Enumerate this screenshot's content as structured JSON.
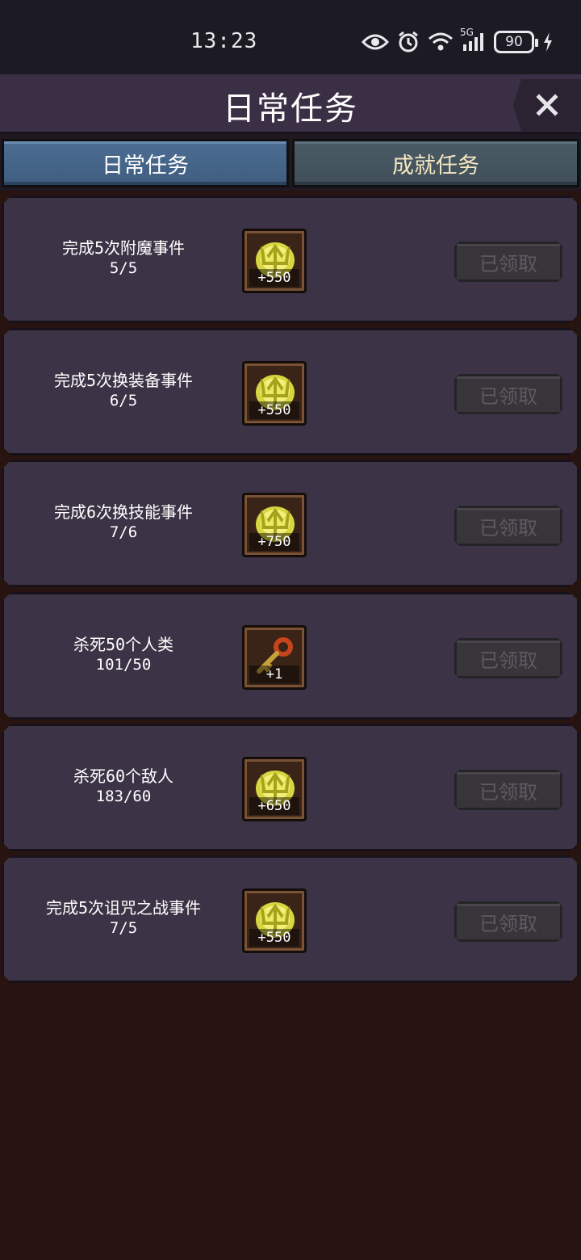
{
  "status_bar": {
    "time": "13:23",
    "network": "5G",
    "battery": "90",
    "icons": [
      "eye-icon",
      "alarm-icon",
      "wifi-icon",
      "signal-icon",
      "battery-icon",
      "charging-icon"
    ]
  },
  "header": {
    "title": "日常任务",
    "close_icon": "close-icon"
  },
  "tabs": [
    {
      "label": "日常任务",
      "active": true
    },
    {
      "label": "成就任务",
      "active": false
    }
  ],
  "tasks": [
    {
      "title": "完成5次附魔事件",
      "progress": "5/5",
      "reward_icon": "gold-crown-icon",
      "reward_amount": "+550",
      "button": "已领取"
    },
    {
      "title": "完成5次换装备事件",
      "progress": "6/5",
      "reward_icon": "gold-crown-icon",
      "reward_amount": "+550",
      "button": "已领取"
    },
    {
      "title": "完成6次换技能事件",
      "progress": "7/6",
      "reward_icon": "gold-crown-icon",
      "reward_amount": "+750",
      "button": "已领取"
    },
    {
      "title": "杀死50个人类",
      "progress": "101/50",
      "reward_icon": "key-icon",
      "reward_amount": "+1",
      "button": "已领取"
    },
    {
      "title": "杀死60个敌人",
      "progress": "183/60",
      "reward_icon": "gold-crown-icon",
      "reward_amount": "+650",
      "button": "已领取"
    },
    {
      "title": "完成5次诅咒之战事件",
      "progress": "7/5",
      "reward_icon": "gold-crown-icon",
      "reward_amount": "+550",
      "button": "已领取"
    }
  ]
}
